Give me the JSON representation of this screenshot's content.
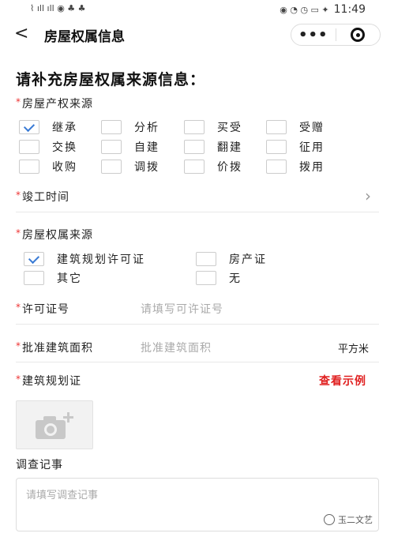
{
  "statusbar": {
    "left_glyphs": "⌇ ıll ıll ◉ ♣ ♣",
    "right_glyphs": "◉ ◔ ◷ ▭ ✦",
    "time": "11:49"
  },
  "navbar": {
    "back_icon": "chevron-left",
    "title": "房屋权属信息",
    "more_dots": "•••"
  },
  "form": {
    "section_title": "请补充房屋权属来源信息：",
    "required_mark": "*",
    "property_source": {
      "label": "房屋产权来源",
      "options": [
        {
          "label": "继承",
          "checked": true
        },
        {
          "label": "分析",
          "checked": false
        },
        {
          "label": "买受",
          "checked": false
        },
        {
          "label": "受赠",
          "checked": false
        },
        {
          "label": "交换",
          "checked": false
        },
        {
          "label": "自建",
          "checked": false
        },
        {
          "label": "翻建",
          "checked": false
        },
        {
          "label": "征用",
          "checked": false
        },
        {
          "label": "收购",
          "checked": false
        },
        {
          "label": "调拨",
          "checked": false
        },
        {
          "label": "价拨",
          "checked": false
        },
        {
          "label": "拨用",
          "checked": false
        }
      ]
    },
    "completion_time": {
      "label": "竣工时间"
    },
    "ownership_source": {
      "label": "房屋权属来源",
      "options": [
        {
          "label": "建筑规划许可证",
          "checked": true
        },
        {
          "label": "房产证",
          "checked": false
        },
        {
          "label": "其它",
          "checked": false
        },
        {
          "label": "无",
          "checked": false
        }
      ]
    },
    "permit_number": {
      "label": "许可证号",
      "placeholder": "请填写可许证号"
    },
    "approved_area": {
      "label": "批准建筑面积",
      "placeholder": "批准建筑面积",
      "unit": "平方米"
    },
    "planning_permit": {
      "label": "建筑规划证",
      "example_link": "查看示例"
    },
    "survey_notes": {
      "label": "调查记事",
      "placeholder": "请填写调查记事"
    }
  },
  "watermark": {
    "text": "玉二文艺"
  },
  "colors": {
    "accent_red": "#e02020",
    "check_blue": "#3a7bd5"
  }
}
